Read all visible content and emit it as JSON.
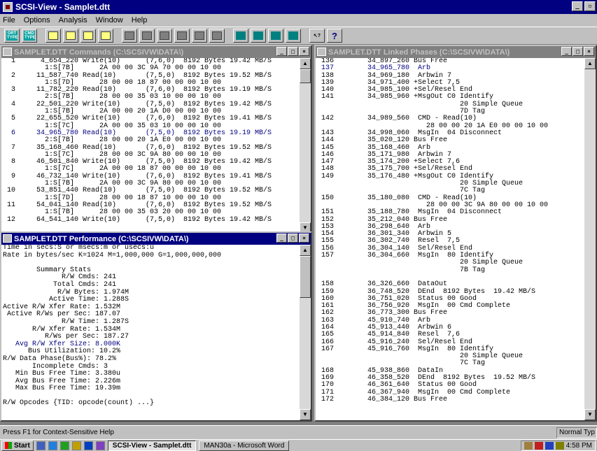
{
  "app": {
    "title": "SCSI-View - Samplet.dtt"
  },
  "menu": [
    "File",
    "Options",
    "Analysis",
    "Window",
    "Help"
  ],
  "toolbar": {
    "btn1": "ORT TYPE",
    "btn2": "CMD TYPE"
  },
  "win_commands": {
    "title": "SAMPLET.DTT Commands (C:\\SCSIVW\\DATA\\)",
    "rows": [
      {
        "text": "  1      4_654_220 Write(10)      (7,6,0)  8192 Bytes 19.42 MB/S",
        "hl": false
      },
      {
        "text": "          1:S[7B]      2A 00 00 3C 9A 70 00 00 10 00",
        "hl": false
      },
      {
        "text": "  2     11_587_740 Read(10)       (7,5,0)  8192 Bytes 19.52 MB/S",
        "hl": false
      },
      {
        "text": "          1:S[7D]      28 00 00 18 87 00 00 00 10 00",
        "hl": false
      },
      {
        "text": "  3     11_782_220 Read(10)       (7,6,0)  8192 Bytes 19.19 MB/S",
        "hl": false
      },
      {
        "text": "          2:S[7B]      28 00 00 35 03 10 00 00 10 00",
        "hl": false
      },
      {
        "text": "  4     22_501_220 Write(10)      (7,5,0)  8192 Bytes 19.42 MB/S",
        "hl": false
      },
      {
        "text": "          1:S[7B]      2A 00 00 20 1A D0 00 00 10 00",
        "hl": false
      },
      {
        "text": "  5     22_655_520 Write(10)      (7,6,0)  8192 Bytes 19.41 MB/S",
        "hl": false
      },
      {
        "text": "          1:S[7C]      2A 00 00 35 03 10 00 00 10 00",
        "hl": false
      },
      {
        "text": "  6     34_965_780 Read(10)       (7,5,0)  8192 Bytes 19.19 MB/S",
        "hl": true
      },
      {
        "text": "          2:S[7B]      28 00 00 20 1A E0 00 00 10 00",
        "hl": false
      },
      {
        "text": "  7     35_168_460 Read(10)       (7,6,0)  8192 Bytes 19.52 MB/S",
        "hl": false
      },
      {
        "text": "          1:S[7C]      28 00 00 3C 9A 80 00 00 10 00",
        "hl": false
      },
      {
        "text": "  8     46_501_840 Write(10)      (7,5,0)  8192 Bytes 19.42 MB/S",
        "hl": false
      },
      {
        "text": "          1:S[7C]      2A 00 00 18 87 00 00 00 10 00",
        "hl": false
      },
      {
        "text": "  9     46_732_140 Write(10)      (7,6,0)  8192 Bytes 19.41 MB/S",
        "hl": false
      },
      {
        "text": "          1:S[7B]      2A 00 00 3C 9A 80 00 00 10 00",
        "hl": false
      },
      {
        "text": " 10     53_851_440 Read(10)       (7,5,0)  8192 Bytes 19.52 MB/S",
        "hl": false
      },
      {
        "text": "          1:S[7D]      28 00 00 18 87 10 00 00 10 00",
        "hl": false
      },
      {
        "text": " 11     54_041_140 Read(10)       (7,6,0)  8192 Bytes 19.52 MB/S",
        "hl": false
      },
      {
        "text": "          1:S[7B]      28 00 00 35 03 20 00 00 10 00",
        "hl": false
      },
      {
        "text": " 12     64_541_140 Write(10)      (7,5,0)  8192 Bytes 19.42 MB/S",
        "hl": false
      }
    ]
  },
  "win_perf": {
    "title": "SAMPLET.DTT Performance (C:\\SCSIVW\\DATA\\)",
    "rows": [
      {
        "text": "Time in secs:S or msecs:m or usecs:u",
        "hl": false
      },
      {
        "text": "Rate in bytes/sec K=1024 M=1,000,000 G=1,000,000,000",
        "hl": false
      },
      {
        "text": "",
        "hl": false
      },
      {
        "text": "        Summary Stats",
        "hl": false
      },
      {
        "text": "              R/W Cmds: 241",
        "hl": false
      },
      {
        "text": "            Total Cmds: 241",
        "hl": false
      },
      {
        "text": "             R/W Bytes: 1.974M",
        "hl": false
      },
      {
        "text": "           Active Time: 1.288S",
        "hl": false
      },
      {
        "text": "Active R/W Xfer Rate: 1.532M",
        "hl": false
      },
      {
        "text": " Active R/Ws per Sec: 187.07",
        "hl": false
      },
      {
        "text": "              R/W Time: 1.287S",
        "hl": false
      },
      {
        "text": "       R/W Xfer Rate: 1.534M",
        "hl": false
      },
      {
        "text": "          R/Ws per Sec: 187.27",
        "hl": false
      },
      {
        "text": "   Avg R/W Xfer Size: 8.000K",
        "hl": true
      },
      {
        "text": "      Bus Utilization: 10.2%",
        "hl": false
      },
      {
        "text": "R/W Data Phase(Bus%): 78.2%",
        "hl": false
      },
      {
        "text": "       Incomplete Cmds: 3",
        "hl": false
      },
      {
        "text": "   Min Bus Free Time: 3.380u",
        "hl": false
      },
      {
        "text": "   Avg Bus Free Time: 2.226m",
        "hl": false
      },
      {
        "text": "   Max Bus Free Time: 19.39m",
        "hl": false
      },
      {
        "text": "",
        "hl": false
      },
      {
        "text": "R/W Opcodes {TID: opcode(count) ...}",
        "hl": false
      }
    ]
  },
  "win_phases": {
    "title": "SAMPLET.DTT Linked Phases (C:\\SCSIVW\\DATA\\)",
    "rows": [
      {
        "text": " 136        34_897_260 Bus Free",
        "hl": false
      },
      {
        "text": " 137        34_965_780  Arb",
        "hl": true
      },
      {
        "text": " 138        34_969_180  Arbwin 7",
        "hl": false
      },
      {
        "text": " 139        34_971_400 +Select 7,5",
        "hl": false
      },
      {
        "text": " 140        34_985_100 +Sel/Resel End",
        "hl": false
      },
      {
        "text": " 141        34_985_960 +MsgOut C0 Identify",
        "hl": false
      },
      {
        "text": "                                  20 Simple Queue",
        "hl": false
      },
      {
        "text": "                                  7D Tag",
        "hl": false
      },
      {
        "text": " 142        34_989_560  CMD - Read(10)",
        "hl": false
      },
      {
        "text": "                          28 00 00 20 1A E0 00 00 10 00",
        "hl": false
      },
      {
        "text": " 143        34_998_060  MsgIn  04 Disconnect",
        "hl": false
      },
      {
        "text": " 144        35_020_120 Bus Free",
        "hl": false
      },
      {
        "text": " 145        35_168_460  Arb",
        "hl": false
      },
      {
        "text": " 146        35_171_980  Arbwin 7",
        "hl": false
      },
      {
        "text": " 147        35_174_200 +Select 7,6",
        "hl": false
      },
      {
        "text": " 148        35_175_700 +Sel/Resel End",
        "hl": false
      },
      {
        "text": " 149        35_176_480 +MsgOut C0 Identify",
        "hl": false
      },
      {
        "text": "                                  20 Simple Queue",
        "hl": false
      },
      {
        "text": "                                  7C Tag",
        "hl": false
      },
      {
        "text": " 150        35_180_080  CMD - Read(10)",
        "hl": false
      },
      {
        "text": "                          28 00 00 3C 9A 80 00 00 10 00",
        "hl": false
      },
      {
        "text": " 151        35_188_780  MsgIn  04 Disconnect",
        "hl": false
      },
      {
        "text": " 152        35_212_040 Bus Free",
        "hl": false
      },
      {
        "text": " 153        36_298_640  Arb",
        "hl": false
      },
      {
        "text": " 154        36_301_340  Arbwin 5",
        "hl": false
      },
      {
        "text": " 155        36_302_740  Resel  7,5",
        "hl": false
      },
      {
        "text": " 156        36_304_140  Sel/Resel End",
        "hl": false
      },
      {
        "text": " 157        36_304_660  MsgIn  80 Identify",
        "hl": false
      },
      {
        "text": "                                  20 Simple Queue",
        "hl": false
      },
      {
        "text": "                                  7B Tag",
        "hl": false
      },
      {
        "text": "",
        "hl": false
      },
      {
        "text": " 158        36_326_660  DataOut",
        "hl": false
      },
      {
        "text": " 159        36_748_520  DEnd  8192 Bytes  19.42 MB/S",
        "hl": false
      },
      {
        "text": " 160        36_751_020  Status 00 Good",
        "hl": false
      },
      {
        "text": " 161        36_756_920  MsgIn  00 Cmd Complete",
        "hl": false
      },
      {
        "text": " 162        36_773_300 Bus Free",
        "hl": false
      },
      {
        "text": " 163        45_910_740  Arb",
        "hl": false
      },
      {
        "text": " 164        45_913_440  Arbwin 6",
        "hl": false
      },
      {
        "text": " 165        45_914_840  Resel  7,6",
        "hl": false
      },
      {
        "text": " 166        45_916_240  Sel/Resel End",
        "hl": false
      },
      {
        "text": " 167        45_916_760  MsgIn  80 Identify",
        "hl": false
      },
      {
        "text": "                                  20 Simple Queue",
        "hl": false
      },
      {
        "text": "                                  7C Tag",
        "hl": false
      },
      {
        "text": " 168        45_938_860  DataIn",
        "hl": false
      },
      {
        "text": " 169        46_358_520  DEnd  8192 Bytes  19.52 MB/S",
        "hl": false
      },
      {
        "text": " 170        46_361_640  Status 00 Good",
        "hl": false
      },
      {
        "text": " 171        46_367_940  MsgIn  00 Cmd Complete",
        "hl": false
      },
      {
        "text": " 172        46_384_120 Bus Free",
        "hl": false
      }
    ]
  },
  "status": {
    "help": "Press F1 for Context-Sensitive Help",
    "mode": "Normal Typ"
  },
  "taskbar": {
    "start": "Start",
    "task1": "SCSI-View - Samplet.dtt",
    "task2": "MAN30a - Microsoft Word",
    "clock": "4:58 PM"
  },
  "colors": {
    "title_active": "#000080",
    "highlight": "#000080"
  }
}
